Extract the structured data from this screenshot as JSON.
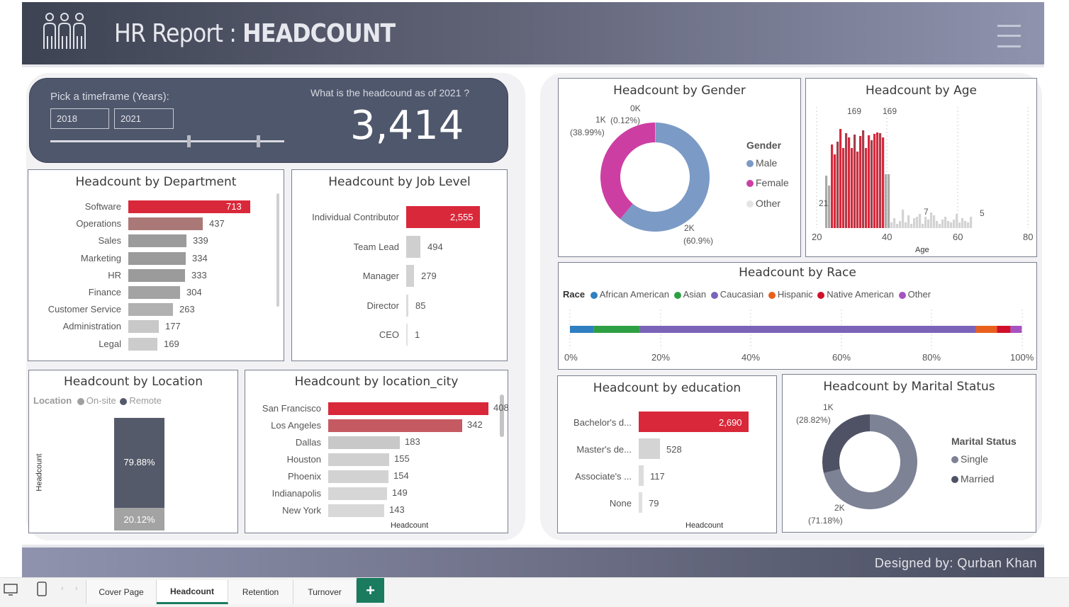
{
  "header": {
    "title": "HR Report : ",
    "title_bold": "HEADCOUNT"
  },
  "timeframe": {
    "label": "Pick a timeframe (Years):",
    "start": "2018",
    "end": "2021"
  },
  "kpi": {
    "question": "What is the headcound as of 2021 ?",
    "value": "3,414"
  },
  "department": {
    "title": "Headcount by Department",
    "items": [
      {
        "label": "Software",
        "value": 713
      },
      {
        "label": "Operations",
        "value": 437
      },
      {
        "label": "Sales",
        "value": 339
      },
      {
        "label": "Marketing",
        "value": 334
      },
      {
        "label": "HR",
        "value": 333
      },
      {
        "label": "Finance",
        "value": 304
      },
      {
        "label": "Customer Service",
        "value": 263
      },
      {
        "label": "Administration",
        "value": 177
      },
      {
        "label": "Legal",
        "value": 169
      }
    ]
  },
  "job_level": {
    "title": "Headcount by Job Level",
    "items": [
      {
        "label": "Individual Contributor",
        "value": "2,555",
        "num": 2555
      },
      {
        "label": "Team Lead",
        "value": "494",
        "num": 494
      },
      {
        "label": "Manager",
        "value": "279",
        "num": 279
      },
      {
        "label": "Director",
        "value": "85",
        "num": 85
      },
      {
        "label": "CEO",
        "value": "1",
        "num": 1
      }
    ]
  },
  "location": {
    "title": "Headcount by Location",
    "legend_title": "Location",
    "legend": [
      "On-site",
      "Remote"
    ],
    "ylabel": "Headcount",
    "remote_pct": "79.88%",
    "onsite_pct": "20.12%"
  },
  "city": {
    "title": "Headcount by location_city",
    "xlabel": "Headcount",
    "items": [
      {
        "label": "San Francisco",
        "value": 408
      },
      {
        "label": "Los Angeles",
        "value": 342
      },
      {
        "label": "Dallas",
        "value": 183
      },
      {
        "label": "Houston",
        "value": 155
      },
      {
        "label": "Phoenix",
        "value": 154
      },
      {
        "label": "Indianapolis",
        "value": 149
      },
      {
        "label": "New York",
        "value": 143
      }
    ]
  },
  "gender": {
    "title": "Headcount by Gender",
    "legend_title": "Gender",
    "legend": [
      "Male",
      "Female",
      "Other"
    ],
    "labels": {
      "top": "0K",
      "top_pct": "(0.12%)",
      "left": "1K",
      "left_pct": "(38.99%)",
      "bottom": "2K",
      "bottom_pct": "(60.9%)"
    },
    "male_pct": 60.9,
    "female_pct": 38.99,
    "other_pct": 0.12
  },
  "age": {
    "title": "Headcount by Age",
    "xlabel": "Age",
    "ticks": [
      "20",
      "40",
      "60",
      "80"
    ],
    "annotations": [
      "169",
      "169",
      "21",
      "7",
      "5"
    ]
  },
  "race": {
    "title": "Headcount by Race",
    "legend_title": "Race",
    "legend": [
      "African American",
      "Asian",
      "Caucasian",
      "Hispanic",
      "Native American",
      "Other"
    ],
    "ticks": [
      "0%",
      "20%",
      "40%",
      "60%",
      "80%",
      "100%"
    ]
  },
  "education": {
    "title": "Headcount by education",
    "xlabel": "Headcount",
    "items": [
      {
        "label": "Bachelor's d...",
        "value": "2,690",
        "num": 2690
      },
      {
        "label": "Master's de...",
        "value": "528",
        "num": 528
      },
      {
        "label": "Associate's ...",
        "value": "117",
        "num": 117
      },
      {
        "label": "None",
        "value": "79",
        "num": 79
      }
    ]
  },
  "marital": {
    "title": "Headcount by Marital Status",
    "legend_title": "Marital Status",
    "legend": [
      "Single",
      "Married"
    ],
    "labels": {
      "top": "1K",
      "top_pct": "(28.82%)",
      "bottom": "2K",
      "bottom_pct": "(71.18%)"
    },
    "single_pct": 71.18,
    "married_pct": 28.82
  },
  "footer": {
    "credit": "Designed by: Qurban Khan"
  },
  "tabs": [
    "Cover Page",
    "Headcount",
    "Retention",
    "Turnover"
  ],
  "colors": {
    "accent": "#d9283a",
    "navy": "#4a5267",
    "male": "#7b9ac6",
    "female": "#cd3ea3"
  },
  "chart_data": [
    {
      "type": "bar",
      "title": "Headcount by Department",
      "categories": [
        "Software",
        "Operations",
        "Sales",
        "Marketing",
        "HR",
        "Finance",
        "Customer Service",
        "Administration",
        "Legal"
      ],
      "values": [
        713,
        437,
        339,
        334,
        333,
        304,
        263,
        177,
        169
      ]
    },
    {
      "type": "bar",
      "title": "Headcount by Job Level",
      "categories": [
        "Individual Contributor",
        "Team Lead",
        "Manager",
        "Director",
        "CEO"
      ],
      "values": [
        2555,
        494,
        279,
        85,
        1
      ]
    },
    {
      "type": "bar",
      "title": "Headcount by location_city",
      "categories": [
        "San Francisco",
        "Los Angeles",
        "Dallas",
        "Houston",
        "Phoenix",
        "Indianapolis",
        "New York"
      ],
      "values": [
        408,
        342,
        183,
        155,
        154,
        149,
        143
      ]
    },
    {
      "type": "bar",
      "title": "Headcount by education",
      "categories": [
        "Bachelor's d...",
        "Master's de...",
        "Associate's ...",
        "None"
      ],
      "values": [
        2690,
        528,
        117,
        79
      ]
    },
    {
      "type": "pie",
      "title": "Headcount by Gender",
      "categories": [
        "Male",
        "Female",
        "Other"
      ],
      "values": [
        60.9,
        38.99,
        0.12
      ]
    },
    {
      "type": "pie",
      "title": "Headcount by Marital Status",
      "categories": [
        "Single",
        "Married"
      ],
      "values": [
        71.18,
        28.82
      ]
    },
    {
      "type": "bar",
      "title": "Headcount by Location",
      "categories": [
        "On-site",
        "Remote"
      ],
      "values": [
        20.12,
        79.88
      ]
    },
    {
      "type": "bar",
      "title": "Headcount by Race",
      "categories": [
        "African American",
        "Asian",
        "Caucasian",
        "Hispanic",
        "Native American",
        "Other"
      ],
      "values": [
        5.3,
        10.2,
        74.3,
        4.6,
        3.0,
        2.5
      ]
    }
  ]
}
